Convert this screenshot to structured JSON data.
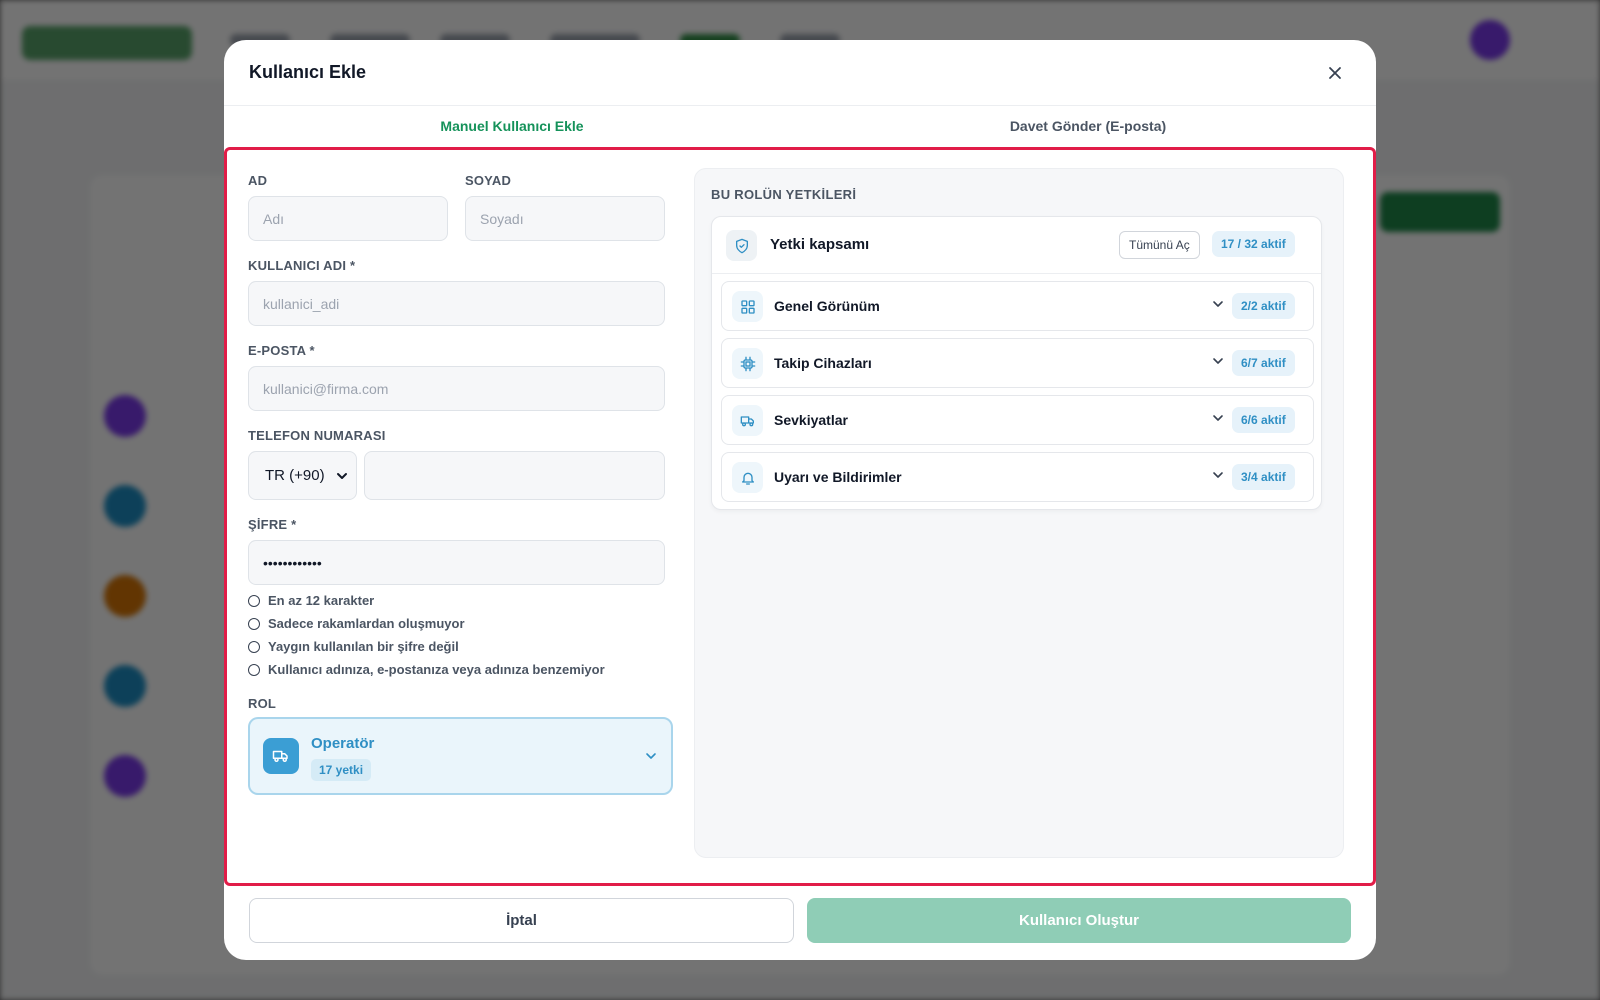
{
  "modal": {
    "title": "Kullanıcı Ekle",
    "close_icon": "close-icon"
  },
  "tabs": [
    {
      "label": "Manuel Kullanıcı Ekle",
      "active": true
    },
    {
      "label": "Davet Gönder (E-posta)",
      "active": false
    }
  ],
  "form": {
    "first_name": {
      "label": "AD",
      "placeholder": "Adı",
      "value": ""
    },
    "last_name": {
      "label": "SOYAD",
      "placeholder": "Soyadı",
      "value": ""
    },
    "username": {
      "label": "KULLANICI ADI *",
      "placeholder": "kullanici_adi",
      "value": ""
    },
    "email": {
      "label": "E-POSTA *",
      "placeholder": "kullanici@firma.com",
      "value": ""
    },
    "phone": {
      "label": "TELEFON NUMARASI",
      "country_code": "TR (+90)",
      "value": ""
    },
    "password": {
      "label": "ŞİFRE *",
      "value": "••••••••••••"
    },
    "password_rules": [
      "En az 12 karakter",
      "Sadece rakamlardan oluşmuyor",
      "Yaygın kullanılan bir şifre değil",
      "Kullanıcı adınıza, e-postanıza veya adınıza benzemiyor"
    ],
    "role": {
      "label": "ROL",
      "name": "Operatör",
      "badge": "17 yetki",
      "icon": "truck-icon"
    }
  },
  "permissions": {
    "title": "BU ROLÜN YETKİLERİ",
    "scope_title": "Yetki kapsamı",
    "expand_all": "Tümünü Aç",
    "total": "17 / 32 aktif",
    "groups": [
      {
        "name": "Genel Görünüm",
        "count": "2/2 aktif",
        "icon": "grid-icon"
      },
      {
        "name": "Takip Cihazları",
        "count": "6/7 aktif",
        "icon": "chip-icon"
      },
      {
        "name": "Sevkiyatlar",
        "count": "6/6 aktif",
        "icon": "truck-icon"
      },
      {
        "name": "Uyarı ve Bildirimler",
        "count": "3/4 aktif",
        "icon": "bell-icon"
      }
    ]
  },
  "footer": {
    "cancel": "İptal",
    "create": "Kullanıcı Oluştur"
  },
  "colors": {
    "accent_green": "#15925a",
    "accent_blue": "#2f8fc4",
    "highlight_border": "#e11d48",
    "create_button": "#8fcdb6"
  }
}
